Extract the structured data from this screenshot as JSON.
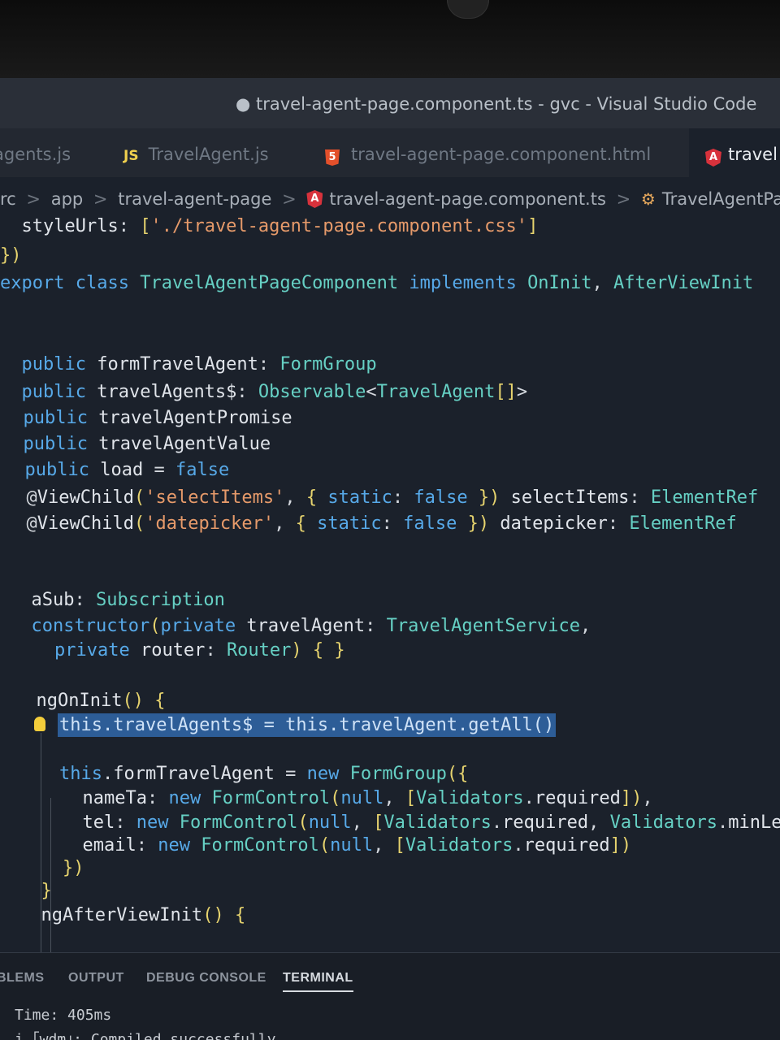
{
  "window": {
    "title": "● travel-agent-page.component.ts - gvc - Visual Studio Code"
  },
  "tabs": [
    {
      "label": "agents.js"
    },
    {
      "icon": "JS",
      "label": "TravelAgent.js"
    },
    {
      "icon": "5",
      "label": "travel-agent-page.component.html"
    },
    {
      "icon": "A",
      "label": "travel"
    }
  ],
  "breadcrumb": {
    "items": [
      "rc",
      "app",
      "travel-agent-page",
      "travel-agent-page.component.ts",
      "TravelAgentPageCor"
    ],
    "separator": ">"
  },
  "code": {
    "lines": [
      "  styleUrls: ['./travel-agent-page.component.css']",
      "})",
      "export class TravelAgentPageComponent implements OnInit, AfterViewInit",
      "  public formTravelAgent: FormGroup",
      "  public travelAgents$: Observable<TravelAgent[]>",
      "  public travelAgentPromise",
      "  public travelAgentValue",
      "  public load = false",
      "  @ViewChild('selectItems', { static: false }) selectItems: ElementRef",
      "  @ViewChild('datepicker', { static: false }) datepicker: ElementRef",
      "  aSub: Subscription",
      "  constructor(private travelAgent: TravelAgentService,",
      "    private router: Router) { }",
      "  ngOnInit() {",
      "    this.travelAgents$ = this.travelAgent.getAll()",
      "    this.formTravelAgent = new FormGroup({",
      "      nameTa: new FormControl(null, [Validators.required]),",
      "      tel: new FormControl(null, [Validators.required, Validators.minLengt",
      "      email: new FormControl(null, [Validators.required])",
      "    })",
      "  }",
      "  ngAfterViewInit() {"
    ]
  },
  "panel": {
    "tabs": [
      "BLEMS",
      "OUTPUT",
      "DEBUG CONSOLE",
      "TERMINAL"
    ],
    "active_tab": "TERMINAL",
    "terminal_lines": [
      "Time: 405ms",
      "i ｢wdm｣: Compiled successfully."
    ]
  }
}
